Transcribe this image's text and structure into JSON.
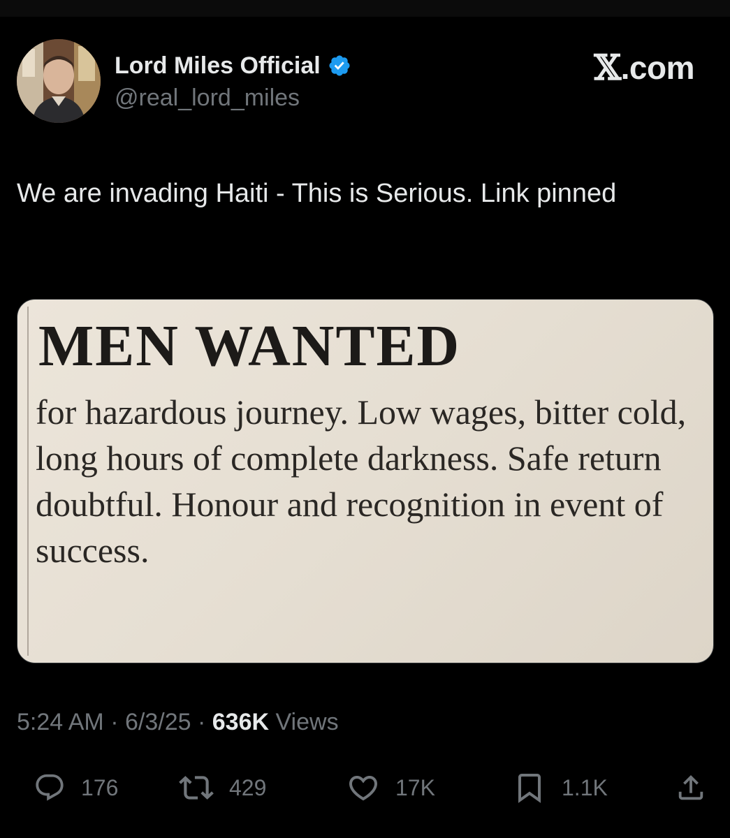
{
  "author": {
    "display_name": "Lord Miles Official",
    "handle": "@real_lord_miles",
    "verified": true
  },
  "brand": {
    "label": "X.com",
    "x_glyph": "𝕏",
    "suffix": ".com"
  },
  "tweet": {
    "text": "We are invading Haiti - This is Serious. Link pinned"
  },
  "media": {
    "headline": "MEN WANTED",
    "body": "for hazardous journey. Low wages, bitter cold, long hours of complete darkness. Safe return doubtful. Honour and recognition in event of success."
  },
  "meta": {
    "time": "5:24 AM",
    "date": "6/3/25",
    "views_count": "636K",
    "views_label": "Views",
    "separator": "·"
  },
  "actions": {
    "replies": "176",
    "reposts": "429",
    "likes": "17K",
    "bookmarks": "1.1K"
  },
  "colors": {
    "background": "#000000",
    "text_primary": "#e7e9ea",
    "text_secondary": "#71767b",
    "verified_blue": "#1d9bf0"
  }
}
